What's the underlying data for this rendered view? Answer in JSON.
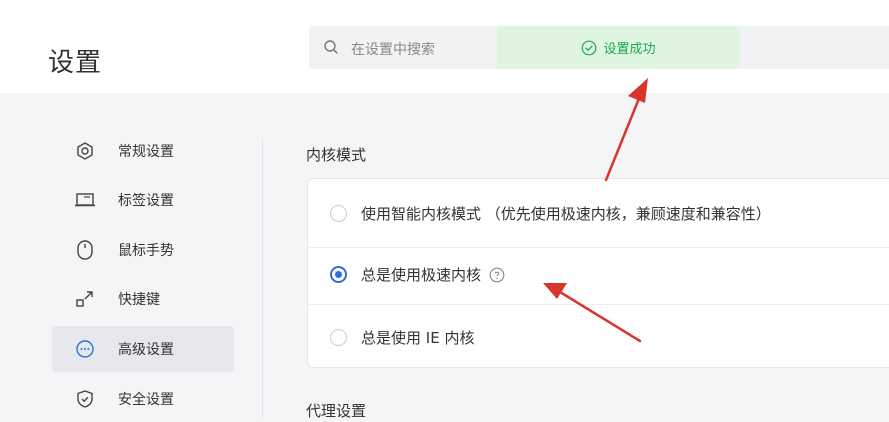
{
  "page": {
    "title": "设置"
  },
  "search": {
    "placeholder": "在设置中搜索"
  },
  "toast": {
    "text": "设置成功"
  },
  "sidebar": {
    "items": [
      {
        "label": "常规设置",
        "icon": "general-settings-icon",
        "active": false
      },
      {
        "label": "标签设置",
        "icon": "tab-settings-icon",
        "active": false
      },
      {
        "label": "鼠标手势",
        "icon": "mouse-icon",
        "active": false
      },
      {
        "label": "快捷键",
        "icon": "shortcut-icon",
        "active": false
      },
      {
        "label": "高级设置",
        "icon": "advanced-icon",
        "active": true
      },
      {
        "label": "安全设置",
        "icon": "shield-icon",
        "active": false
      }
    ]
  },
  "kernel": {
    "title": "内核模式",
    "options": [
      {
        "label": "使用智能内核模式 （优先使用极速内核，兼顾速度和兼容性）",
        "checked": false
      },
      {
        "label": "总是使用极速内核",
        "checked": true
      },
      {
        "label": "总是使用 IE 内核",
        "checked": false
      }
    ]
  },
  "proxy": {
    "title": "代理设置"
  },
  "colors": {
    "accent": "#2c6fde",
    "success": "#23a55a",
    "annotation": "#d9352b"
  }
}
